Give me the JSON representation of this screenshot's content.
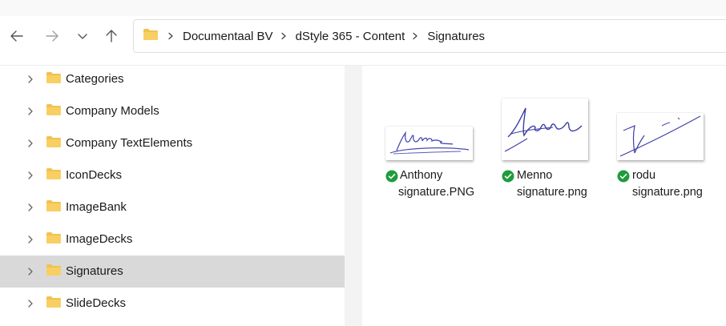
{
  "nav": {
    "back": "back-arrow-icon",
    "forward": "forward-arrow-icon",
    "recent": "chevron-down-icon",
    "up": "up-arrow-icon"
  },
  "breadcrumb": {
    "items": [
      "Documentaal BV",
      "dStyle 365 - Content",
      "Signatures"
    ]
  },
  "sidebar": {
    "items": [
      {
        "label": "Categories"
      },
      {
        "label": "Company Models"
      },
      {
        "label": "Company TextElements"
      },
      {
        "label": "IconDecks"
      },
      {
        "label": "ImageBank"
      },
      {
        "label": "ImageDecks"
      },
      {
        "label": "Signatures",
        "selected": true
      },
      {
        "label": "SlideDecks"
      }
    ]
  },
  "files": [
    {
      "line1": "Anthony",
      "line2": "signature.PNG",
      "status": "synced-check-icon"
    },
    {
      "line1": "Menno",
      "line2": "signature.png",
      "status": "synced-check-icon"
    },
    {
      "line1": "rodu",
      "line2": "signature.png",
      "status": "synced-check-icon"
    }
  ],
  "colors": {
    "folder": "#f2c14e",
    "selected_row": "#d9d9d9",
    "status_green": "#1e9c3c",
    "ink": "#4b4bb0"
  }
}
